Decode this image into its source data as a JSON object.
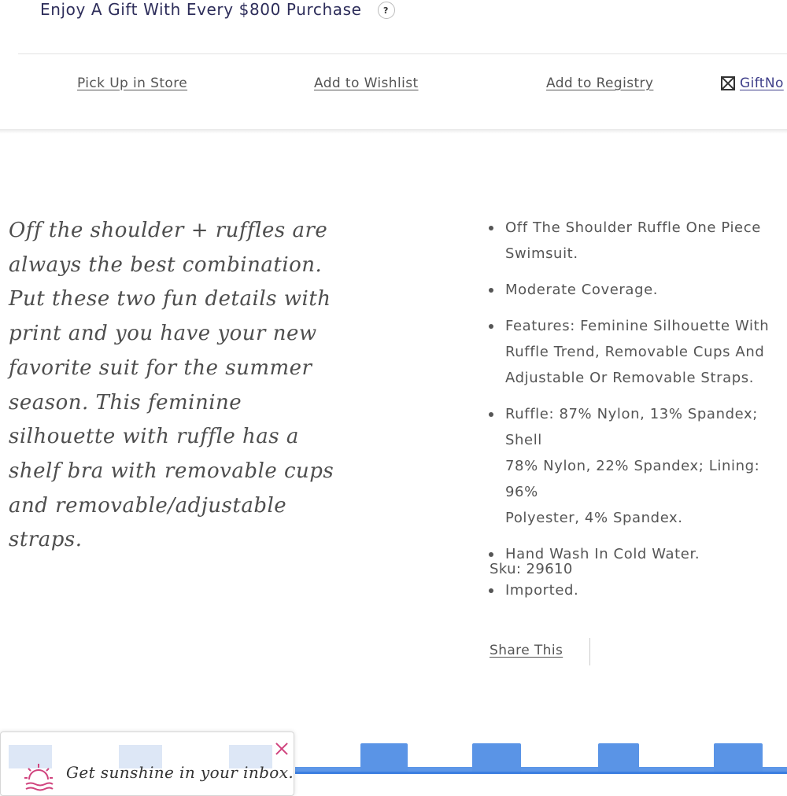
{
  "promo": {
    "text": "Enjoy A Gift With Every $800 Purchase",
    "help_icon": "?"
  },
  "actions": {
    "pickup": "Pick Up in Store",
    "wishlist": "Add to Wishlist",
    "registry": "Add to Registry",
    "giftnote": "GiftNo"
  },
  "description": "Off the shoulder + ruffles are always the best combination. Put these two fun details with print and you have your new favorite suit for the summer season. This feminine silhouette with ruffle has a shelf bra with removable cups and removable/adjustable straps.",
  "features": [
    "Off The Shoulder Ruffle One Piece\nSwimsuit.",
    "Moderate Coverage.",
    "Features: Feminine Silhouette With\nRuffle Trend, Removable Cups And\nAdjustable Or Removable Straps.",
    "Ruffle: 87% Nylon, 13% Spandex; Shell\n78% Nylon, 22% Spandex; Lining: 96%\nPolyester, 4% Spandex.",
    "Hand Wash In Cold Water.",
    "Imported."
  ],
  "sku": "Sku: 29610",
  "share": "Share This",
  "popup": {
    "text": "Get sunshine in your inbox."
  },
  "colors": {
    "accent_pink": "#d0447e",
    "navy": "#2d2d5a",
    "band_blue": "#5e97e8"
  },
  "icons": {
    "gift": "giftnote-icon",
    "close": "close-icon",
    "sun": "sunrise-icon"
  }
}
